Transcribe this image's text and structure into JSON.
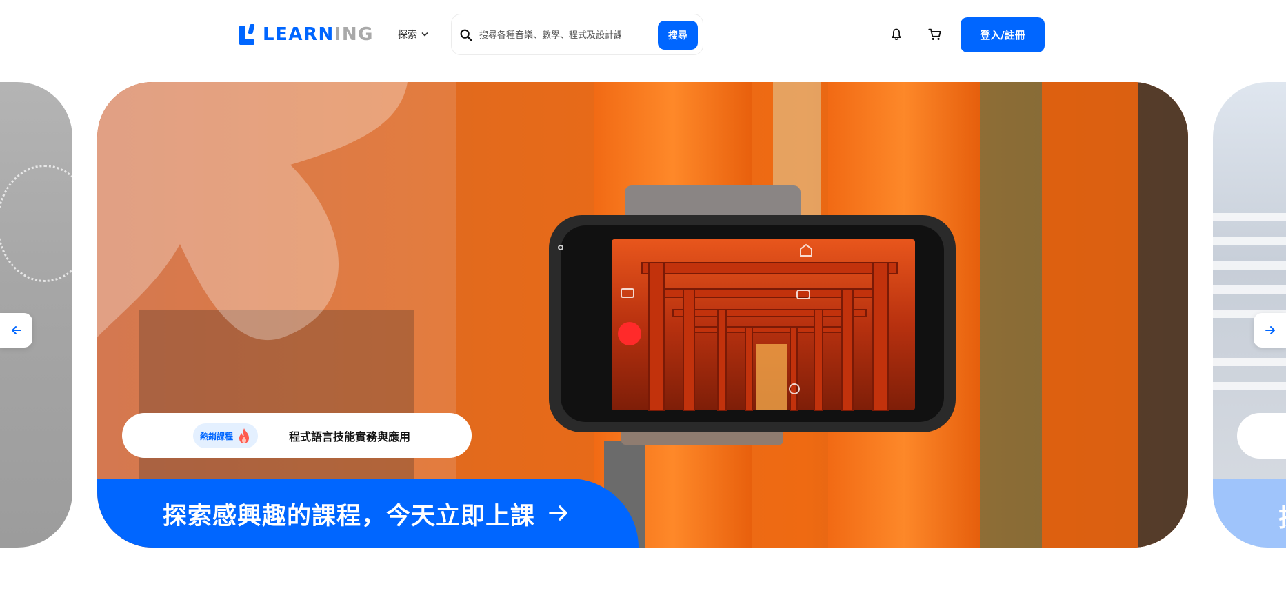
{
  "header": {
    "logo": {
      "part_blue": "LEARN",
      "part_gray": "ING"
    },
    "explore_label": "探索",
    "search": {
      "placeholder": "搜尋各種音樂、數學、程式及設計課程",
      "button_label": "搜尋"
    },
    "login_label": "登入/註冊"
  },
  "carousel": {
    "current": {
      "badge_label": "熱銷課程",
      "course_title": "程式語言技能實務與應用",
      "cta_label": "探索感興趣的課程，今天立即上課",
      "image": "smartphone-on-gimbal-filming-torii-gates"
    },
    "next_peek_char": "探"
  },
  "icons": {
    "logo": "logo-mark-icon",
    "explore": "chevron-down-icon",
    "search": "search-icon",
    "notifications": "bell-icon",
    "cart": "cart-icon",
    "prev": "arrow-left-icon",
    "next": "arrow-right-icon",
    "cta": "arrow-right-icon",
    "badge": "fire-icon"
  },
  "colors": {
    "primary": "#0066ff",
    "badge_bg": "#e4f0ff",
    "logo_gray": "#a9a9a9",
    "fire": "#ff5a4e"
  }
}
